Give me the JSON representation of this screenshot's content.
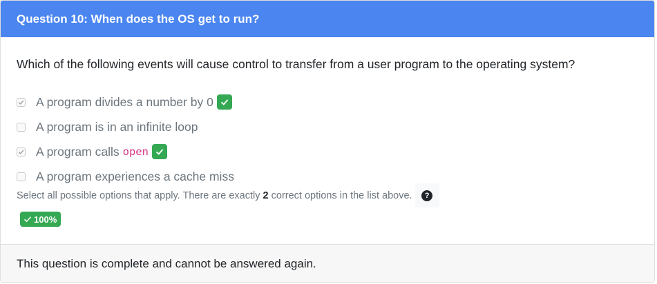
{
  "header": {
    "title": "Question 10: When does the OS get to run?"
  },
  "question": {
    "prompt": "Which of the following events will cause control to transfer from a user program to the operating system?",
    "options": [
      {
        "label": "A program divides a number by 0",
        "checked": true,
        "correct": true
      },
      {
        "label": "A program is in an infinite loop",
        "checked": false,
        "correct": false
      },
      {
        "label": "A program calls",
        "code": "open",
        "checked": true,
        "correct": true
      },
      {
        "label": "A program experiences a cache miss",
        "checked": false,
        "correct": false
      }
    ],
    "hint_prefix": "Select all possible options that apply. There are exactly",
    "hint_count": "2",
    "hint_suffix": "correct options in the list above.",
    "help_symbol": "?",
    "score": "100%"
  },
  "footer": {
    "message": "This question is complete and cannot be answered again."
  },
  "colors": {
    "header_bg": "#4a85f0",
    "correct_green": "#34a853",
    "code_pink": "#d63384"
  }
}
